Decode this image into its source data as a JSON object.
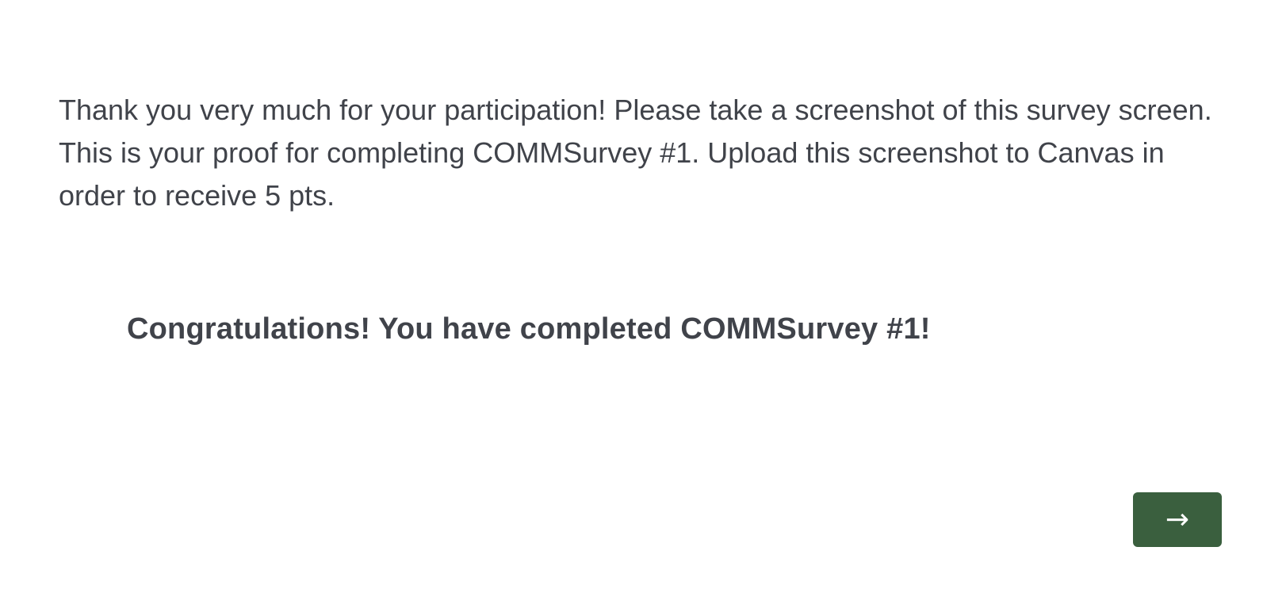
{
  "survey": {
    "instructions": [
      "Thank you very much for your participation! Please take a screenshot of this survey screen.",
      "This is your proof for completing COMMSurvey #1. Upload this screenshot to Canvas in order to receive 5 pts."
    ],
    "congratulations": "Congratulations! You have completed COMMSurvey #1!"
  },
  "navigation": {
    "next_button_label": "→"
  },
  "colors": {
    "text": "#40434a",
    "button_background": "#3a5f3e",
    "button_text": "#ffffff",
    "page_background": "#ffffff"
  }
}
